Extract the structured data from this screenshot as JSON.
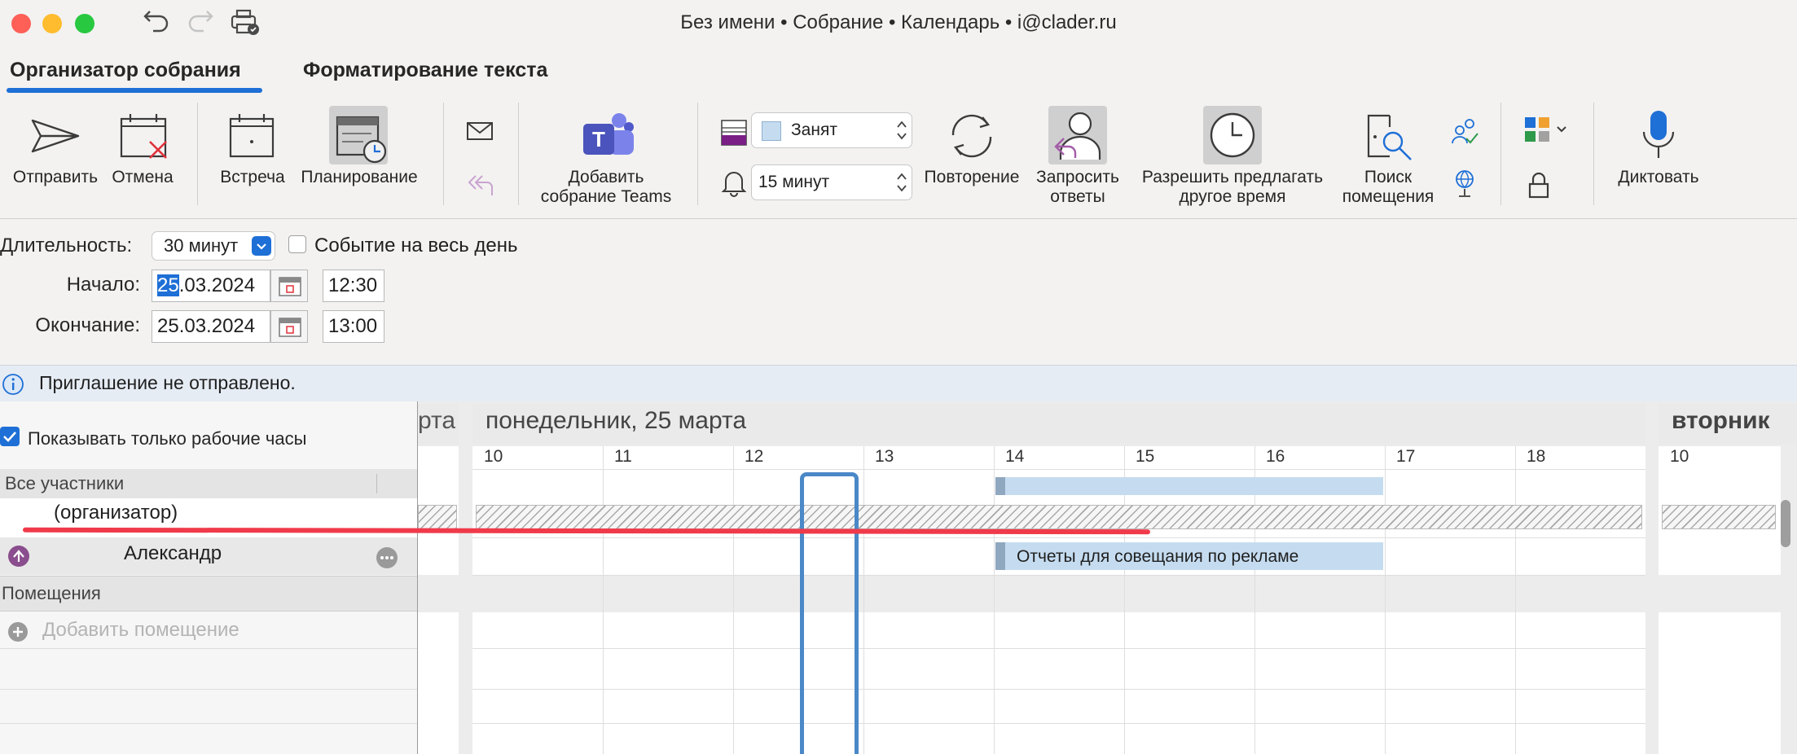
{
  "window": {
    "title": "Без имени • Собрание • Календарь • i@clader.ru",
    "traffic_colors": [
      "#fe5f57",
      "#febc2e",
      "#28c840"
    ]
  },
  "tabs": [
    {
      "label": "Организатор собрания",
      "active": true
    },
    {
      "label": "Форматирование текста",
      "active": false
    }
  ],
  "ribbon": {
    "send": "Отправить",
    "cancel": "Отмена",
    "meeting": "Встреча",
    "scheduling": "Планирование",
    "teams": "Добавить\nсобрание Teams",
    "status_value": "Занят",
    "reminder_value": "15 минут",
    "recurrence": "Повторение",
    "request_responses": "Запросить\nответы",
    "allow_new_time": "Разрешить предлагать\nдругое время",
    "room_finder": "Поиск\nпомещения",
    "dictate": "Диктовать"
  },
  "form": {
    "duration_label": "Длительность:",
    "duration_value": "30 минут",
    "all_day_label": "Событие на весь день",
    "all_day_checked": false,
    "start_label": "Начало:",
    "start_day": "25",
    "start_date_rest": ".03.2024",
    "start_time": "12:30",
    "end_label": "Окончание:",
    "end_date": "25.03.2024",
    "end_time": "13:00"
  },
  "info": {
    "message": "Приглашение не отправлено."
  },
  "scheduling": {
    "show_work_hours_label": "Показывать только рабочие часы",
    "show_work_hours_checked": true,
    "prev_day_fragment": "рта",
    "day_label": "понедельник, 25 марта",
    "next_day_label": "вторник",
    "hours": [
      "10",
      "11",
      "12",
      "13",
      "14",
      "15",
      "16",
      "17",
      "18"
    ],
    "next_day_first_hour": "10",
    "all_attendees": "Все участники",
    "organizer": "(организатор)",
    "attendee_name": "Александр",
    "event_title": "Отчеты для совещания по рекламе",
    "rooms_label": "Помещения",
    "add_room": "Добавить помещение"
  },
  "colors": {
    "accent": "#1e6fd6",
    "busy_block": "#c5dcf0",
    "selection_outline": "#4a88c8",
    "annotation_line": "#f03a4a"
  }
}
